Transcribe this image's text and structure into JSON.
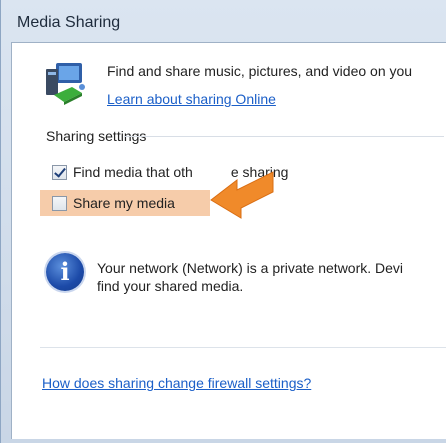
{
  "window": {
    "title": "Media Sharing"
  },
  "intro": {
    "text": "Find and share music, pictures, and video on you",
    "learn_link": "Learn about sharing Online"
  },
  "sharing_settings": {
    "group_label": "Sharing settings",
    "find_media": {
      "label": "Find media that oth",
      "label_tail": "e sharing",
      "checked": true
    },
    "share_my_media": {
      "label": "Share my media",
      "checked": false
    }
  },
  "info": {
    "line1": "Your network (Network) is a private network. Devi",
    "line2": "find your shared media."
  },
  "firewall_link": "How does sharing change firewall settings?",
  "colors": {
    "highlight": "#f6ccaa",
    "arrow": "#f08a2a",
    "link": "#1b5fc8"
  },
  "icons": [
    "network-sharing-icon",
    "info-icon",
    "pointer-arrow-icon"
  ]
}
